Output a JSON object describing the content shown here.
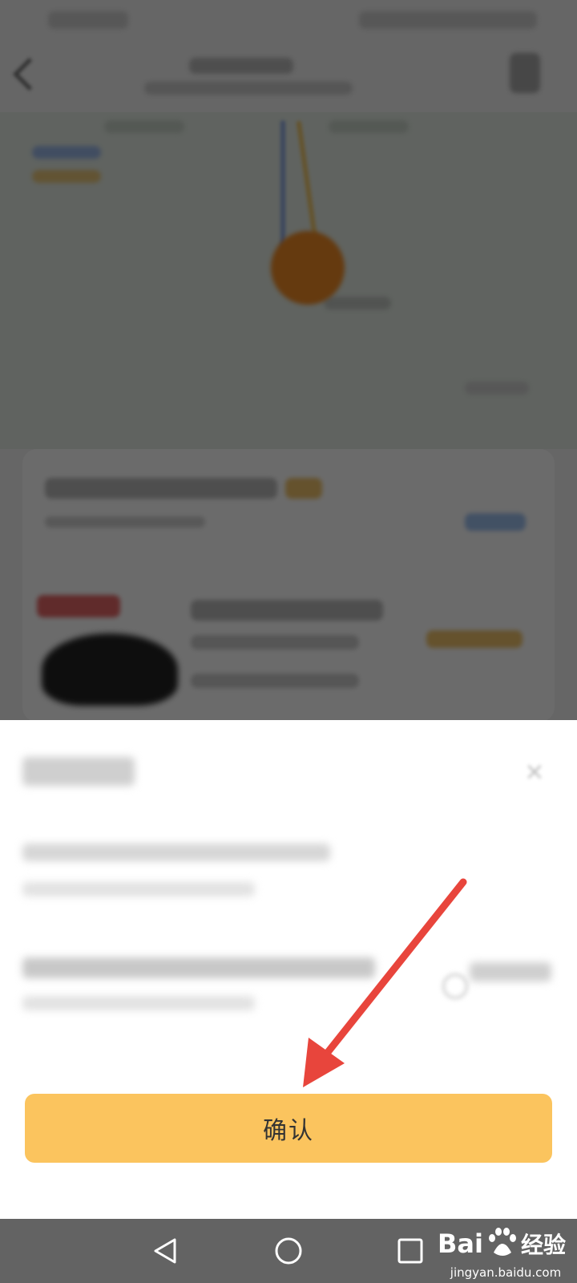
{
  "sheet": {
    "confirm_label": "确认"
  },
  "navbar": {
    "back_icon": "triangle-back-icon",
    "home_icon": "circle-home-icon",
    "recents_icon": "square-recents-icon"
  },
  "watermark": {
    "brand": "Baidu 经验",
    "url": "jingyan.baidu.com"
  },
  "colors": {
    "confirm_button": "#fbc45e",
    "annotation_arrow": "#e8453c",
    "navbar": "#636363",
    "overlay": "rgba(0,0,0,0.58)"
  }
}
